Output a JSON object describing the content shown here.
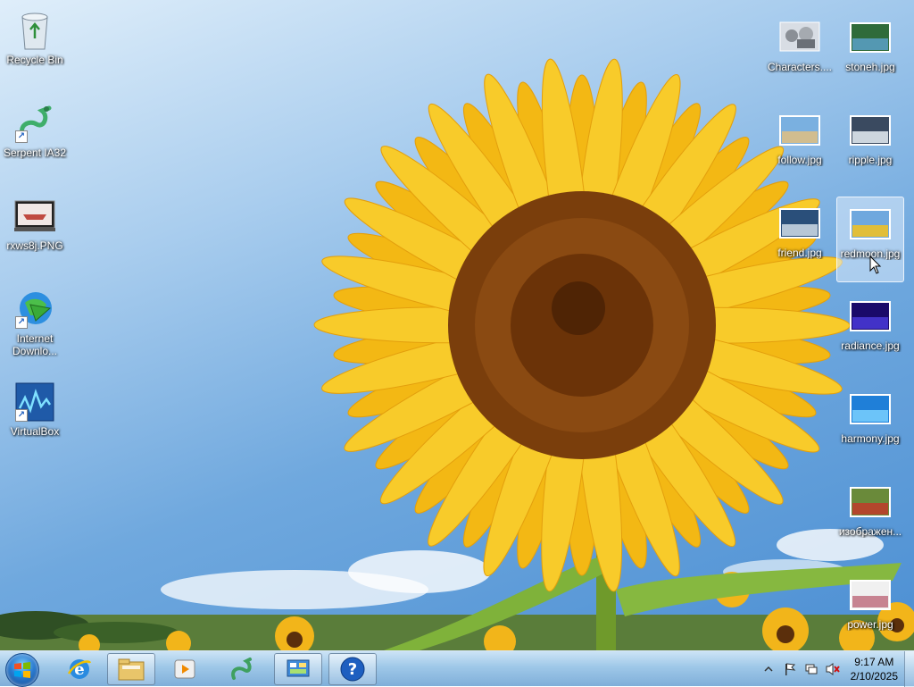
{
  "desktop": {
    "left_icons": [
      {
        "label": "Recycle Bin",
        "icon": "recycle-bin-icon",
        "shortcut": false
      },
      {
        "label": "Serpent IA32",
        "icon": "serpent-icon",
        "shortcut": true
      },
      {
        "label": "rxws8j.PNG",
        "icon": "image-file-icon",
        "shortcut": false
      },
      {
        "label": "Internet Downlo...",
        "icon": "internet-download-manager-icon",
        "shortcut": true
      },
      {
        "label": "VirtualBox",
        "icon": "virtualbox-icon",
        "shortcut": true
      }
    ],
    "right_col1": [
      {
        "label": "Characters....",
        "icon": "characters-folder-icon"
      },
      {
        "label": "follow.jpg",
        "icon": "image-thumbnail-icon"
      },
      {
        "label": "friend.jpg",
        "icon": "image-thumbnail-icon"
      }
    ],
    "right_col2": [
      {
        "label": "stoneh.jpg",
        "icon": "image-thumbnail-icon"
      },
      {
        "label": "ripple.jpg",
        "icon": "image-thumbnail-icon"
      },
      {
        "label": "redmoon.jpg",
        "icon": "image-thumbnail-icon",
        "selected": true
      },
      {
        "label": "radiance.jpg",
        "icon": "image-thumbnail-icon"
      },
      {
        "label": "harmony.jpg",
        "icon": "image-thumbnail-icon"
      },
      {
        "label": "изображен...",
        "icon": "image-thumbnail-icon"
      },
      {
        "label": "power.jpg",
        "icon": "image-thumbnail-icon"
      }
    ]
  },
  "taskbar": {
    "pinned": [
      {
        "name": "internet-explorer-icon"
      },
      {
        "name": "file-explorer-icon"
      },
      {
        "name": "media-player-icon"
      },
      {
        "name": "serpent-taskbar-icon"
      },
      {
        "name": "control-panel-icon"
      },
      {
        "name": "help-icon"
      }
    ],
    "clock": {
      "time": "9:17 AM",
      "date": "2/10/2025"
    }
  }
}
